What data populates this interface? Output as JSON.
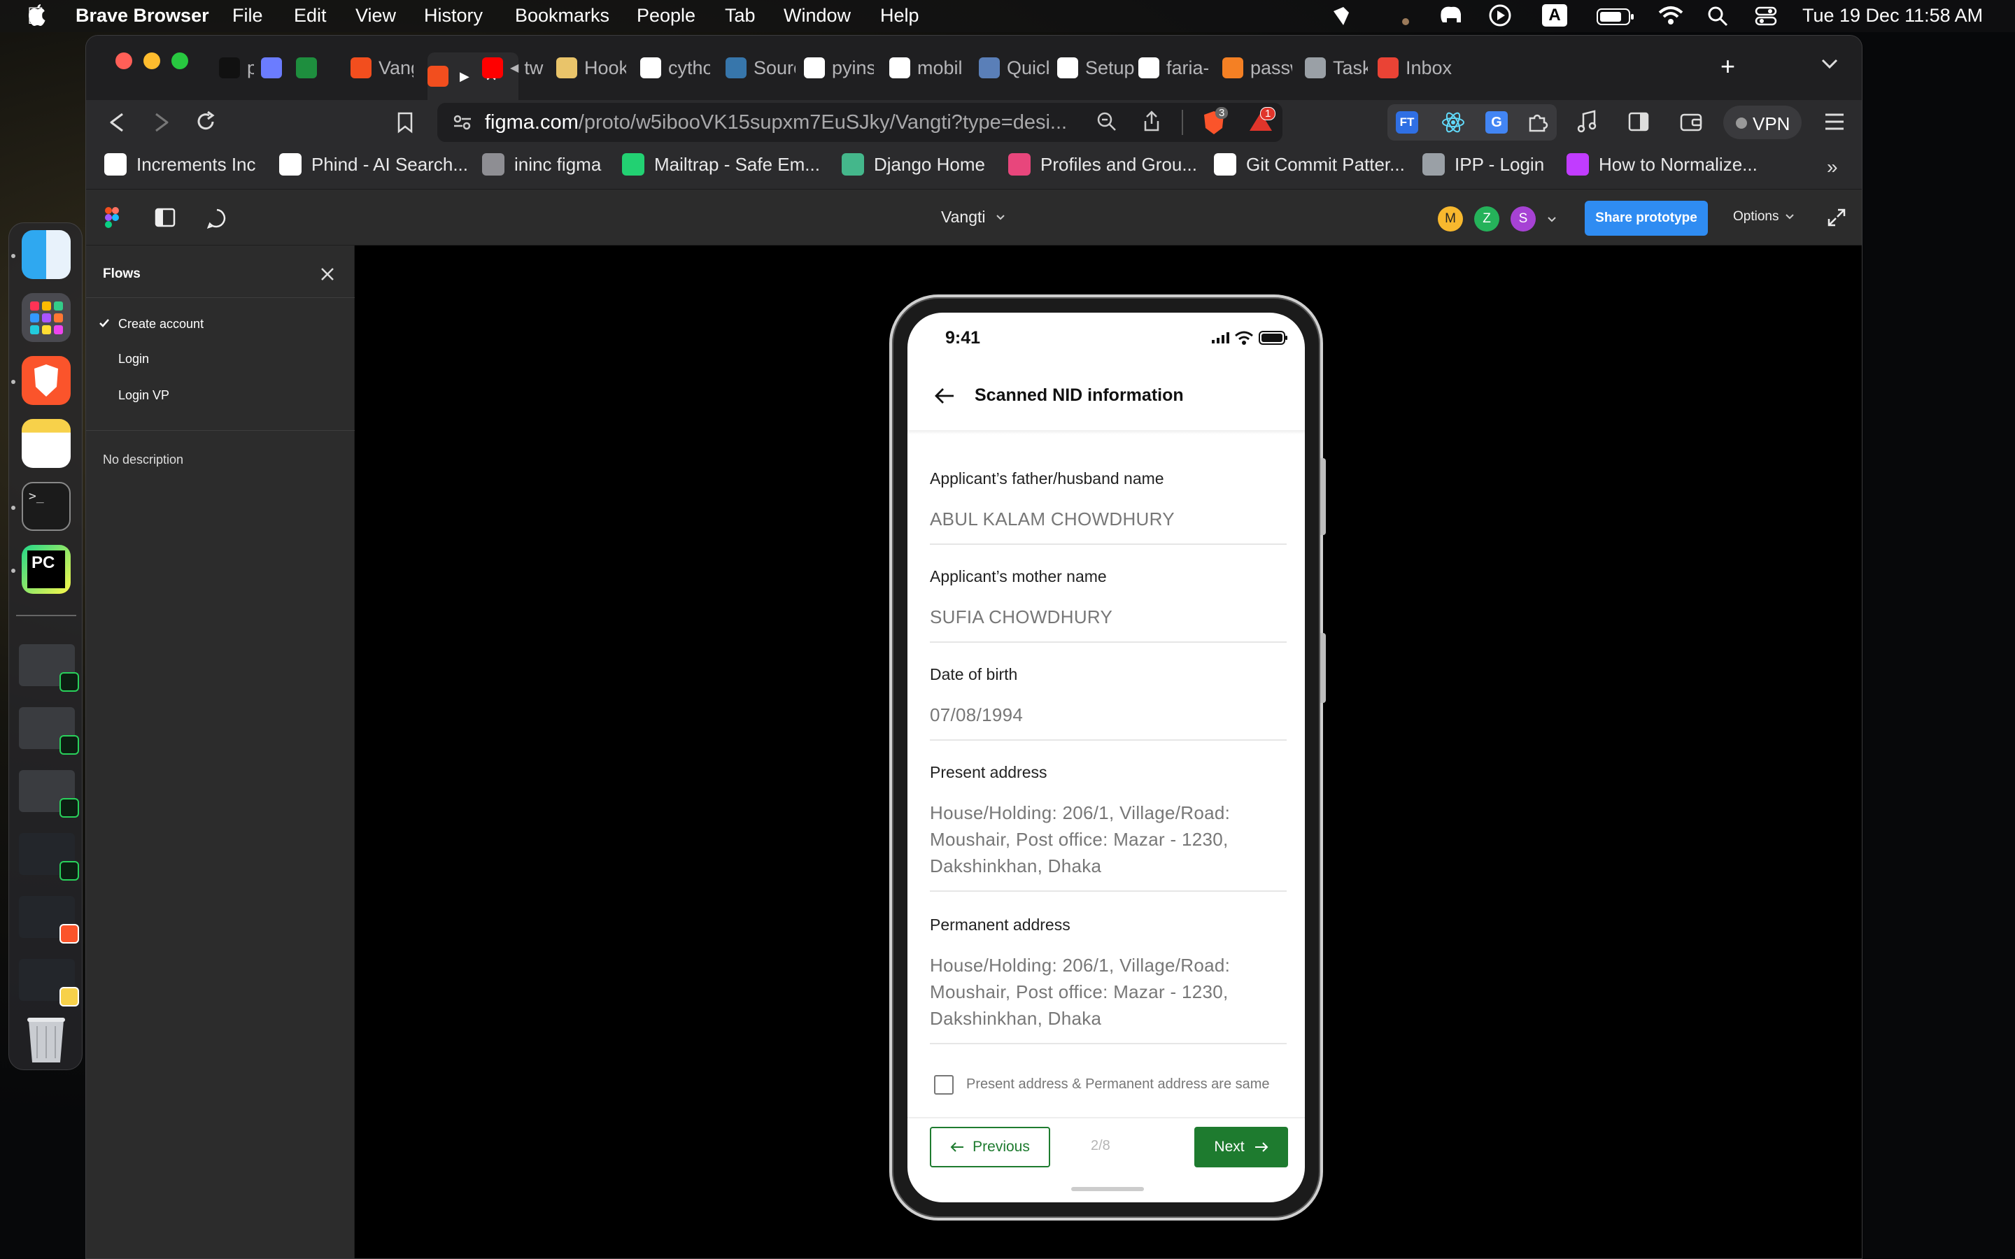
{
  "menubar": {
    "app_name": "Brave Browser",
    "items": [
      "File",
      "Edit",
      "View",
      "History",
      "Bookmarks",
      "People",
      "Tab",
      "Window",
      "Help"
    ],
    "clock": "Tue 19 Dec  11:58 AM",
    "input_source": "A"
  },
  "tabs": [
    {
      "label": "p",
      "icon": "perplexity-icon",
      "color": "#111111"
    },
    {
      "label": "",
      "icon": "gemini-icon",
      "color": "#6b7cff"
    },
    {
      "label": "",
      "icon": "sheets-icon",
      "color": "#1e8e3e"
    },
    {
      "label": "Vangt",
      "icon": "figma-icon",
      "color": "#f24e1e"
    },
    {
      "label": "",
      "icon": "figma-icon",
      "color": "#f24e1e"
    },
    {
      "label": "tw",
      "icon": "youtube-icon",
      "color": "#ff0000"
    },
    {
      "label": "Hook",
      "icon": "book-icon",
      "color": "#e9c46a"
    },
    {
      "label": "cytho",
      "icon": "google-icon",
      "color": "#ffffff"
    },
    {
      "label": "Sourc",
      "icon": "python-icon",
      "color": "#3776ab"
    },
    {
      "label": "pyins",
      "icon": "google-icon",
      "color": "#ffffff"
    },
    {
      "label": "mobil",
      "icon": "github-icon",
      "color": "#ffffff"
    },
    {
      "label": "Quick",
      "icon": "cython-icon",
      "color": "#5a7fb8"
    },
    {
      "label": "Setup",
      "icon": "google-icon",
      "color": "#ffffff"
    },
    {
      "label": "faria-",
      "icon": "github-icon",
      "color": "#ffffff"
    },
    {
      "label": "passw",
      "icon": "stackoverflow-icon",
      "color": "#f48024"
    },
    {
      "label": "Task",
      "icon": "globe-icon",
      "color": "#9aa0a6"
    },
    {
      "label": "Inbox",
      "icon": "gmail-icon",
      "color": "#ea4335"
    }
  ],
  "toolbar": {
    "url_domain": "figma.com",
    "url_path": "/proto/w5ibooVK15supxm7EuSJky/Vangti?type=desi...",
    "shields_badge": "3",
    "rewards_badge": "1",
    "vpn_label": "VPN"
  },
  "bookmarks": [
    {
      "label": "Increments Inc",
      "icon": "github-icon",
      "color": "#ffffff"
    },
    {
      "label": "Phind - AI Search...",
      "icon": "phind-icon",
      "color": "#ffffff"
    },
    {
      "label": "ininc figma",
      "icon": "folder-icon",
      "color": "#8e8e93"
    },
    {
      "label": "Mailtrap - Safe Em...",
      "icon": "mailtrap-icon",
      "color": "#22d172"
    },
    {
      "label": "Django Home",
      "icon": "django-icon",
      "color": "#44b78b"
    },
    {
      "label": "Profiles and Grou...",
      "icon": "profiles-icon",
      "color": "#e8467c"
    },
    {
      "label": "Git Commit Patter...",
      "icon": "dev-icon",
      "color": "#ffffff"
    },
    {
      "label": "IPP - Login",
      "icon": "globe-icon",
      "color": "#9aa0a6"
    },
    {
      "label": "How to Normalize...",
      "icon": "vercel-icon",
      "color": "#c13cff"
    }
  ],
  "figma": {
    "file_name": "Vangti",
    "share_label": "Share prototype",
    "options_label": "Options",
    "avatars": [
      {
        "letter": "M",
        "color": "#f7b82e"
      },
      {
        "letter": "Z",
        "color": "#25b25a"
      },
      {
        "letter": "S",
        "color": "#a642d4"
      }
    ]
  },
  "sidebar": {
    "title": "Flows",
    "flows": [
      {
        "label": "Create account",
        "selected": true
      },
      {
        "label": "Login",
        "selected": false
      },
      {
        "label": "Login VP",
        "selected": false
      }
    ],
    "description": "No description"
  },
  "phone": {
    "time": "9:41",
    "screen_title": "Scanned NID information",
    "fields": [
      {
        "label": "Applicant’s father/husband name",
        "value": "ABUL KALAM CHOWDHURY"
      },
      {
        "label": "Applicant’s mother name",
        "value": "SUFIA CHOWDHURY"
      },
      {
        "label": "Date of birth",
        "value": "07/08/1994"
      },
      {
        "label": "Present address",
        "value": "House/Holding: 206/1, Village/Road: Moushair, Post office: Mazar - 1230, Dakshinkhan, Dhaka"
      },
      {
        "label": "Permanent address",
        "value": "House/Holding: 206/1, Village/Road: Moushair, Post office: Mazar - 1230, Dakshinkhan, Dhaka"
      }
    ],
    "same_address_label": "Present address & Permanent address are same",
    "prev_label": "Previous",
    "next_label": "Next",
    "page_indicator": "2/8",
    "accent_color": "#1e7b2f"
  }
}
